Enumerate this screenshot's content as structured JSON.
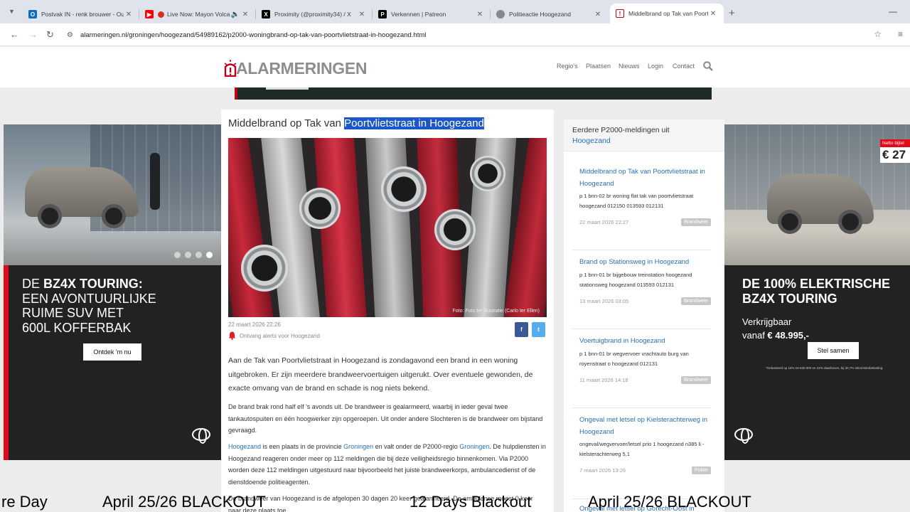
{
  "browser": {
    "tabs": [
      {
        "title": "Postvak IN - renk brouwer - Ou",
        "favicon": "outlook-icon",
        "color": "#0f6cbd"
      },
      {
        "title": "Live Now: Mayon Volcan",
        "favicon": "youtube-icon",
        "color": "#ff0000"
      },
      {
        "title": "Proximity (@proximity34) / X",
        "favicon": "x-icon",
        "color": "#000000"
      },
      {
        "title": "Verkennen | Patreon",
        "favicon": "patreon-icon",
        "color": "#000000"
      },
      {
        "title": "Politieactie Hoogezand",
        "favicon": "globe-icon",
        "color": "#888888"
      },
      {
        "title": "Middelbrand op Tak van Poortv",
        "favicon": "alarmeringen-icon",
        "color": "#c0001a"
      }
    ],
    "url": "alarmeringen.nl/groningen/hoogezand/54989162/p2000-woningbrand-op-tak-van-poortvlietstraat-in-hoogezand.html"
  },
  "header": {
    "logo": "ALARMERINGEN",
    "nav": [
      "Regio's",
      "Plaatsen",
      "Nieuws",
      "Login",
      "Contact"
    ]
  },
  "article": {
    "title_plain": "Middelbrand op Tak van ",
    "title_highlight": "Poortvlietstraat in Hoogezand",
    "photo_credit": "Foto: Foto ter illustratie (Carlo ter Ellen)",
    "date": "22 maart 2026 22:26",
    "alert_link": "Ontvang alerts voor Hoogezand",
    "share_facebook": "f",
    "share_twitter": "t",
    "lead": "Aan de Tak van Poortvlietstraat in Hoogezand is zondagavond een brand in een woning uitgebroken. Er zijn meerdere brandweervoertuigen uitgerukt. Over eventuele gewonden, de exacte omvang van de brand en schade is nog niets bekend.",
    "p1": "De brand brak rond half elf 's avonds uit. De brandweer is gealarmeerd, waarbij in ieder geval twee tankautospuiten en één hoogwerker zijn opgeroepen. Uit onder andere Slochteren is de brandweer om bijstand gevraagd.",
    "p2_link1": "Hoogezand",
    "p2_a": " is een plaats in de provincie ",
    "p2_link2": "Groningen",
    "p2_b": " en valt onder de P2000-regio ",
    "p2_link3": "Groningen",
    "p2_c": ". De hulpdiensten in Hoogezand reageren onder meer op 112 meldingen die bij deze veiligheidsregio binnenkomen. Via P2000 worden deze 112 meldingen uitgestuurd naar bijvoorbeeld het juiste brandweerkorps, ambulancedienst of de dienstdoende politieagenten.",
    "p3": "De brandweer van Hoogezand is de afgelopen 30 dagen 20 keer gealarmeerd. De ambulance moest 0 keer naar deze plaats toe."
  },
  "sidebar": {
    "heading": "Eerdere P2000-meldingen uit",
    "heading_place": "Hoogezand",
    "items": [
      {
        "title": "Middelbrand op Tak van Poortvlietstraat in Hoogezand",
        "desc": "p 1 bnn-02 br woning flat tak van poortvlietstraat hoogezand 012150 013593 012131",
        "date": "22 maart 2026 22:27",
        "badge": "Brandweer"
      },
      {
        "title": "Brand op Stationsweg in Hoogezand",
        "desc": "p 1 bnn-01 br bijgebouw treinstation hoogezand stationsweg hoogezand 013593 012131",
        "date": "13 maart 2026 03:05",
        "badge": "Brandweer"
      },
      {
        "title": "Voertuigbrand in Hoogezand",
        "desc": "p 1 bnn-01 br wegvervoer vrachtauto burg van royenstraat o hoogezand 012131",
        "date": "11 maart 2026 14:18",
        "badge": "Brandweer"
      },
      {
        "title": "Ongeval met letsel op Kielsterachterweg in Hoogezand",
        "desc": "ongeval/wegvervoer/letsel prio 1 hoogezand n385 li - kielsterachterweg 5,1",
        "date": "7 maart 2026 13:26",
        "badge": "Politie"
      },
      {
        "title": "Ongeval met letsel op Gorecht-Oost in",
        "desc": "",
        "date": "",
        "badge": ""
      }
    ]
  },
  "ads": {
    "left": {
      "headline_bold_prefix": "DE ",
      "headline_bold": "BZ4X TOURING:",
      "headline_rest": [
        "EEN AVONTUURLIJKE",
        "RUIME SUV MET",
        "600L KOFFERBAK"
      ],
      "cta": "Ontdek 'm nu"
    },
    "right": {
      "price_label": "Netto bijtel",
      "price_value": "€ 27",
      "headline": [
        "DE 100% ELEKTRISCHE",
        "BZ4X TOURING"
      ],
      "sub1": "Verkrijgbaar",
      "sub2_prefix": "vanaf ",
      "sub2_price": "€ 48.995,-",
      "cta": "Stel samen",
      "fine": "*Gebaseerd op 16% tot €30.000 en 22% daarboven, bij 30,7% inkomstenbelasting."
    }
  },
  "overlay": {
    "items": [
      "re Day",
      "April 25/26 BLACKOUT",
      "12 Days Blackout",
      "April 25/26 BLACKOUT"
    ]
  },
  "colors": {
    "accent": "#c0001a",
    "link": "#2a6fb5",
    "selection": "#1a57c8",
    "toyota_red": "#e10a1d"
  }
}
